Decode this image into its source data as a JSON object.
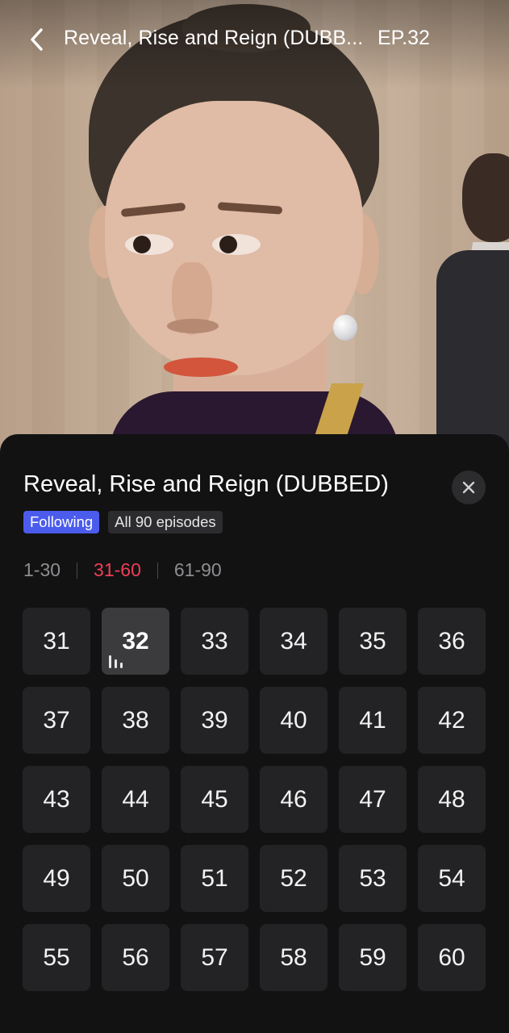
{
  "header": {
    "title": "Reveal, Rise and Reign (DUBB...",
    "episode": "EP.32"
  },
  "sheet": {
    "title": "Reveal, Rise and Reign (DUBBED)",
    "following_label": "Following",
    "episodes_label": "All 90 episodes",
    "ranges": [
      {
        "label": "1-30",
        "active": false
      },
      {
        "label": "31-60",
        "active": true
      },
      {
        "label": "61-90",
        "active": false
      }
    ],
    "current_episode": "32",
    "episodes": [
      "31",
      "32",
      "33",
      "34",
      "35",
      "36",
      "37",
      "38",
      "39",
      "40",
      "41",
      "42",
      "43",
      "44",
      "45",
      "46",
      "47",
      "48",
      "49",
      "50",
      "51",
      "52",
      "53",
      "54",
      "55",
      "56",
      "57",
      "58",
      "59",
      "60"
    ]
  },
  "colors": {
    "accent_active_range": "#ee3f57",
    "following_badge": "#4b5ced"
  },
  "icons": {
    "back": "chevron-left-icon",
    "close": "close-icon",
    "playing": "equalizer-icon"
  }
}
